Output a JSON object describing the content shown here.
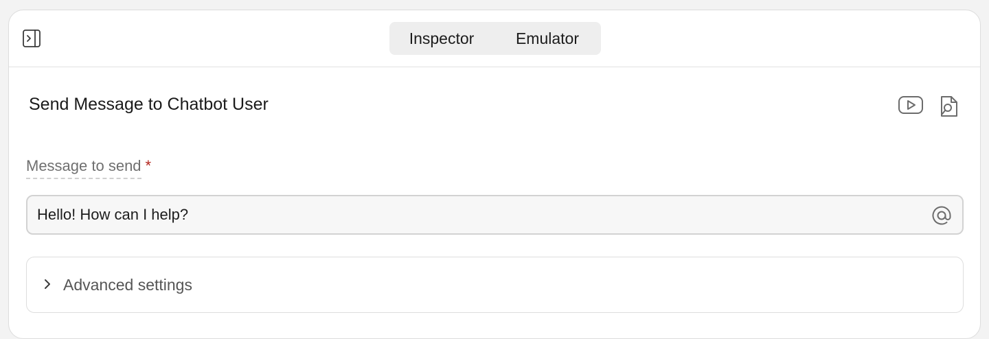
{
  "tabs": [
    {
      "label": "Inspector"
    },
    {
      "label": "Emulator"
    }
  ],
  "step": {
    "title": "Send Message to Chatbot User"
  },
  "field": {
    "label": "Message to send",
    "required_mark": "*",
    "value": "Hello! How can I help?"
  },
  "advanced": {
    "label": "Advanced settings"
  },
  "icons": {
    "sidebar_toggle": "sidebar-expand-icon",
    "video": "youtube-play-icon",
    "docs": "document-search-icon",
    "mention": "at-sign-icon",
    "expand": "chevron-right-icon"
  },
  "colors": {
    "required": "#b3261e",
    "segmented_bg": "#eeeeee",
    "border": "#d2d2d2"
  }
}
